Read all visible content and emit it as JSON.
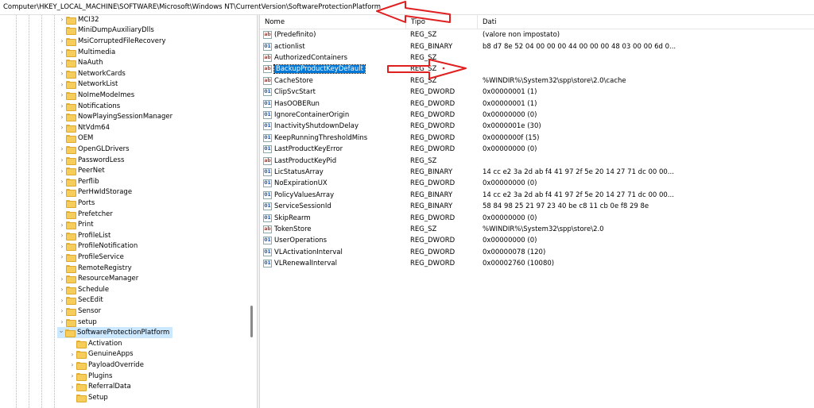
{
  "address_bar": {
    "path": "Computer\\HKEY_LOCAL_MACHINE\\SOFTWARE\\Microsoft\\Windows NT\\CurrentVersion\\SoftwareProtectionPlatform"
  },
  "tree": {
    "items": [
      {
        "label": "MCI32",
        "expandable": true
      },
      {
        "label": "MiniDumpAuxiliaryDlls",
        "expandable": false
      },
      {
        "label": "MsiCorruptedFileRecovery",
        "expandable": true
      },
      {
        "label": "Multimedia",
        "expandable": true
      },
      {
        "label": "NaAuth",
        "expandable": true
      },
      {
        "label": "NetworkCards",
        "expandable": true
      },
      {
        "label": "NetworkList",
        "expandable": true
      },
      {
        "label": "NoImeModeImes",
        "expandable": true
      },
      {
        "label": "Notifications",
        "expandable": true
      },
      {
        "label": "NowPlayingSessionManager",
        "expandable": true
      },
      {
        "label": "NtVdm64",
        "expandable": true
      },
      {
        "label": "OEM",
        "expandable": false
      },
      {
        "label": "OpenGLDrivers",
        "expandable": true
      },
      {
        "label": "PasswordLess",
        "expandable": true
      },
      {
        "label": "PeerNet",
        "expandable": true
      },
      {
        "label": "Perflib",
        "expandable": true
      },
      {
        "label": "PerHwIdStorage",
        "expandable": true
      },
      {
        "label": "Ports",
        "expandable": false
      },
      {
        "label": "Prefetcher",
        "expandable": false
      },
      {
        "label": "Print",
        "expandable": true
      },
      {
        "label": "ProfileList",
        "expandable": true
      },
      {
        "label": "ProfileNotification",
        "expandable": true
      },
      {
        "label": "ProfileService",
        "expandable": true
      },
      {
        "label": "RemoteRegistry",
        "expandable": false
      },
      {
        "label": "ResourceManager",
        "expandable": true
      },
      {
        "label": "Schedule",
        "expandable": true
      },
      {
        "label": "SecEdit",
        "expandable": true
      },
      {
        "label": "Sensor",
        "expandable": true
      },
      {
        "label": "setup",
        "expandable": true
      },
      {
        "label": "SoftwareProtectionPlatform",
        "expandable": true,
        "expanded": true,
        "selected": true
      },
      {
        "label": "Activation",
        "expandable": false,
        "child": true
      },
      {
        "label": "GenuineApps",
        "expandable": true,
        "child": true
      },
      {
        "label": "PayloadOverride",
        "expandable": true,
        "child": true
      },
      {
        "label": "Plugins",
        "expandable": true,
        "child": true
      },
      {
        "label": "ReferralData",
        "expandable": true,
        "child": true
      },
      {
        "label": "Setup",
        "expandable": false,
        "child": true
      }
    ]
  },
  "list": {
    "columns": {
      "name": "Nome",
      "type": "Tipo",
      "data": "Dati"
    },
    "rows": [
      {
        "name": "(Predefinito)",
        "type": "REG_SZ",
        "data": "(valore non impostato)",
        "icon": "string-value-icon"
      },
      {
        "name": "actionlist",
        "type": "REG_BINARY",
        "data": "b8 d7 8e 52 04 00 00 00 44 00 00 00 48 03 00 00 6d 0...",
        "icon": "binary-value-icon"
      },
      {
        "name": "AuthorizedContainers",
        "type": "REG_SZ",
        "data": "",
        "icon": "string-value-icon"
      },
      {
        "name": "BackupProductKeyDefault",
        "type": "REG_SZ",
        "data": "",
        "icon": "string-value-icon",
        "selected": true
      },
      {
        "name": "CacheStore",
        "type": "REG_SZ",
        "data": "%WINDIR%\\System32\\spp\\store\\2.0\\cache",
        "icon": "string-value-icon"
      },
      {
        "name": "ClipSvcStart",
        "type": "REG_DWORD",
        "data": "0x00000001 (1)",
        "icon": "binary-value-icon"
      },
      {
        "name": "HasOOBERun",
        "type": "REG_DWORD",
        "data": "0x00000001 (1)",
        "icon": "binary-value-icon"
      },
      {
        "name": "IgnoreContainerOrigin",
        "type": "REG_DWORD",
        "data": "0x00000000 (0)",
        "icon": "binary-value-icon"
      },
      {
        "name": "InactivityShutdownDelay",
        "type": "REG_DWORD",
        "data": "0x0000001e (30)",
        "icon": "binary-value-icon"
      },
      {
        "name": "KeepRunningThresholdMins",
        "type": "REG_DWORD",
        "data": "0x0000000f (15)",
        "icon": "binary-value-icon"
      },
      {
        "name": "LastProductKeyError",
        "type": "REG_DWORD",
        "data": "0x00000000 (0)",
        "icon": "binary-value-icon"
      },
      {
        "name": "LastProductKeyPid",
        "type": "REG_SZ",
        "data": "",
        "icon": "string-value-icon"
      },
      {
        "name": "LicStatusArray",
        "type": "REG_BINARY",
        "data": "14 cc e2 3a 2d ab f4 41 97 2f 5e 20 14 27 71 dc 00 00...",
        "icon": "binary-value-icon"
      },
      {
        "name": "NoExpirationUX",
        "type": "REG_DWORD",
        "data": "0x00000000 (0)",
        "icon": "binary-value-icon"
      },
      {
        "name": "PolicyValuesArray",
        "type": "REG_BINARY",
        "data": "14 cc e2 3a 2d ab f4 41 97 2f 5e 20 14 27 71 dc 00 00...",
        "icon": "binary-value-icon"
      },
      {
        "name": "ServiceSessionId",
        "type": "REG_BINARY",
        "data": "58 84 98 25 21 97 23 40 be c8 11 cb 0e f8 29 8e",
        "icon": "binary-value-icon"
      },
      {
        "name": "SkipRearm",
        "type": "REG_DWORD",
        "data": "0x00000000 (0)",
        "icon": "binary-value-icon"
      },
      {
        "name": "TokenStore",
        "type": "REG_SZ",
        "data": "%WINDIR%\\System32\\spp\\store\\2.0",
        "icon": "string-value-icon"
      },
      {
        "name": "UserOperations",
        "type": "REG_DWORD",
        "data": "0x00000000 (0)",
        "icon": "binary-value-icon"
      },
      {
        "name": "VLActivationInterval",
        "type": "REG_DWORD",
        "data": "0x00000078 (120)",
        "icon": "binary-value-icon"
      },
      {
        "name": "VLRenewalInterval",
        "type": "REG_DWORD",
        "data": "0x00002760 (10080)",
        "icon": "binary-value-icon"
      }
    ]
  },
  "colors": {
    "selection_blue": "#0078d7",
    "annotation_red": "#e02020",
    "tree_selected_bg": "#cce8ff"
  }
}
